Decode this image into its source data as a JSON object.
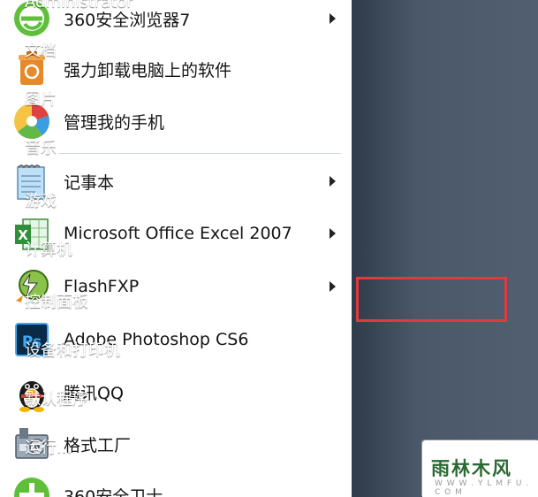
{
  "left_menu": {
    "items": [
      {
        "label": "360安全浏览器7",
        "icon": "360-browser-icon",
        "has_submenu": true
      },
      {
        "label": "强力卸载电脑上的软件",
        "icon": "recycle-bin-icon",
        "has_submenu": false
      },
      {
        "label": "管理我的手机",
        "icon": "phone-manager-icon",
        "has_submenu": false
      },
      {
        "label": "记事本",
        "icon": "notepad-icon",
        "has_submenu": true
      },
      {
        "label": "Microsoft Office Excel 2007",
        "icon": "excel-icon",
        "has_submenu": true
      },
      {
        "label": "FlashFXP",
        "icon": "flashfxp-icon",
        "has_submenu": true
      },
      {
        "label": "Adobe Photoshop CS6",
        "icon": "photoshop-icon",
        "has_submenu": false
      },
      {
        "label": "腾讯QQ",
        "icon": "qq-penguin-icon",
        "has_submenu": false
      },
      {
        "label": "格式工厂",
        "icon": "format-factory-icon",
        "has_submenu": false
      },
      {
        "label": "360安全卫士",
        "icon": "360-safeguard-icon",
        "has_submenu": false
      }
    ]
  },
  "right_menu": {
    "items": [
      {
        "label": "Administrator"
      },
      {
        "label": "文档"
      },
      {
        "label": "图片"
      },
      {
        "label": "音乐"
      },
      {
        "label": "游戏"
      },
      {
        "label": "计算机"
      },
      {
        "label": "控制面板",
        "highlighted": true
      },
      {
        "label": "设备和打印机"
      },
      {
        "label": "默认程序"
      },
      {
        "label": "运行..."
      }
    ]
  },
  "watermark": {
    "logo": "雨林木风",
    "url": "W W W . Y L M F U . C O M"
  },
  "colors": {
    "highlight_border": "#e03a3e",
    "right_pane": "#4a5869"
  }
}
